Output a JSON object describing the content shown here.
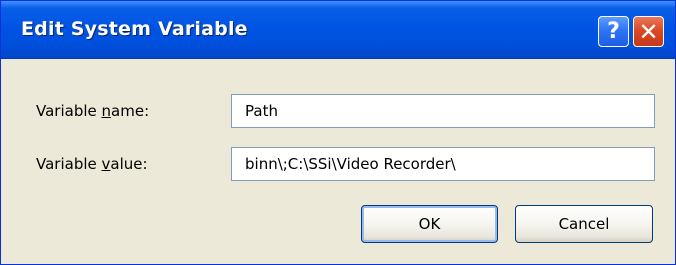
{
  "window": {
    "title": "Edit System Variable",
    "help_glyph": "?",
    "close_glyph": "✕"
  },
  "form": {
    "name_label_prefix": "Variable ",
    "name_label_accel": "n",
    "name_label_suffix": "ame:",
    "name_value": "Path",
    "value_label_prefix": "Variable ",
    "value_label_accel": "v",
    "value_label_suffix": "alue:",
    "value_value": "binn\\;C:\\SSi\\Video Recorder\\"
  },
  "buttons": {
    "ok_label": "OK",
    "cancel_label": "Cancel"
  },
  "colors": {
    "titlebar": "#0054e3",
    "close_button": "#dc4a25",
    "dialog_face": "#ece9d8"
  }
}
